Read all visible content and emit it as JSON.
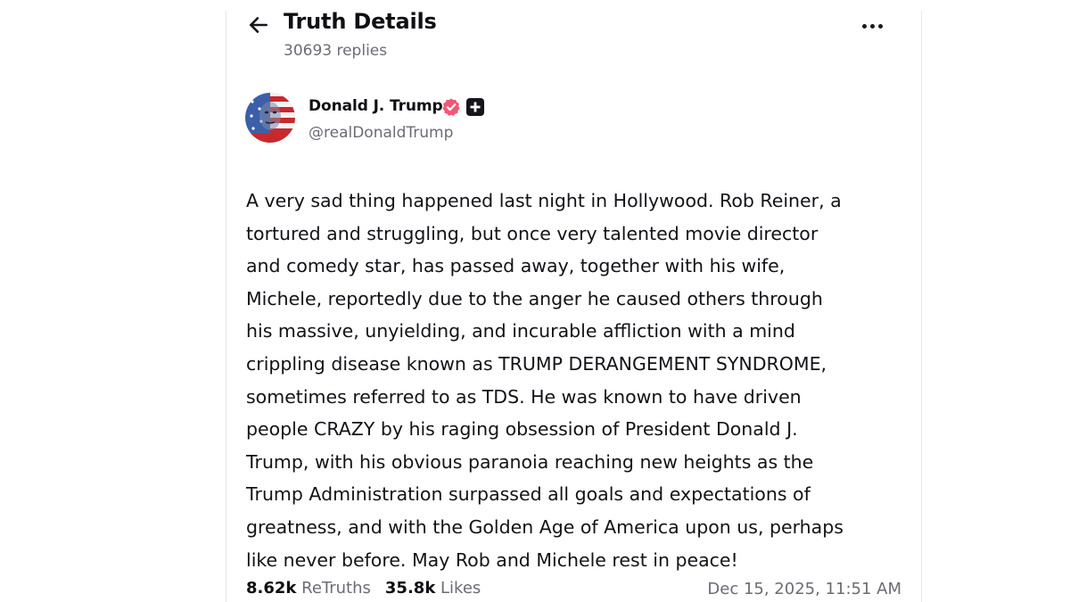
{
  "header": {
    "title": "Truth Details",
    "replies_text": "30693 replies",
    "back_icon": "arrow-left-icon",
    "more_icon": "more-horizontal-icon"
  },
  "author": {
    "name": "Donald J. Trump",
    "handle": "@realDonaldTrump",
    "verified_color": "#f25774",
    "badge_icons": [
      "verified-badge-icon",
      "plus-badge-icon"
    ]
  },
  "post": {
    "lines": [
      "A very sad thing happened last night in Hollywood. Rob Reiner, a",
      "tortured and struggling, but once very talented movie director",
      "and comedy star, has passed away, together with his wife,",
      "Michele, reportedly due to the anger he caused others through",
      "his massive, unyielding, and incurable affliction with a mind",
      "crippling disease known as TRUMP DERANGEMENT SYNDROME,",
      "sometimes referred to as TDS. He was known to have driven",
      "people CRAZY by his raging obsession of President Donald J.",
      "Trump, with his obvious paranoia reaching new heights as the",
      "Trump Administration surpassed all goals and expectations of",
      "greatness, and with the Golden Age of America upon us, perhaps",
      "like never before. May Rob and Michele rest in peace!"
    ]
  },
  "stats": {
    "retruths_count": "8.62k",
    "retruths_label": "ReTruths",
    "likes_count": "35.8k",
    "likes_label": "Likes",
    "timestamp": "Dec 15, 2025, 11:51 AM"
  },
  "colors": {
    "text": "#0f0f14",
    "muted": "#6b6b76",
    "border": "#e6e6ea"
  }
}
